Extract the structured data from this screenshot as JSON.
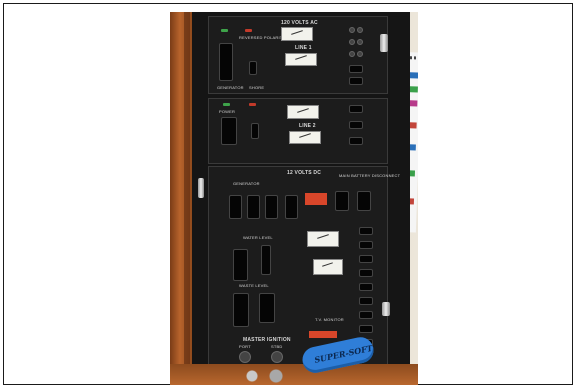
{
  "panel": {
    "ac_title": "120 VOLTS AC",
    "line1": "LINE 1",
    "line2": "LINE 2",
    "dc_title": "12 VOLTS DC",
    "generator": "GENERATOR",
    "shore": "SHORE",
    "power": "POWER",
    "reversed_polarity": "REVERSED POLARITY",
    "main_battery": "MAIN BATTERY DISCONNECT",
    "water_level": "WATER LEVEL",
    "waste_level": "WASTE LEVEL",
    "tv_monitor": "T.V. MONITOR",
    "master_ignition": "MASTER IGNITION",
    "port": "PORT",
    "stbd": "STBD"
  },
  "keyfob": {
    "text": "SUPER-SOFT"
  }
}
